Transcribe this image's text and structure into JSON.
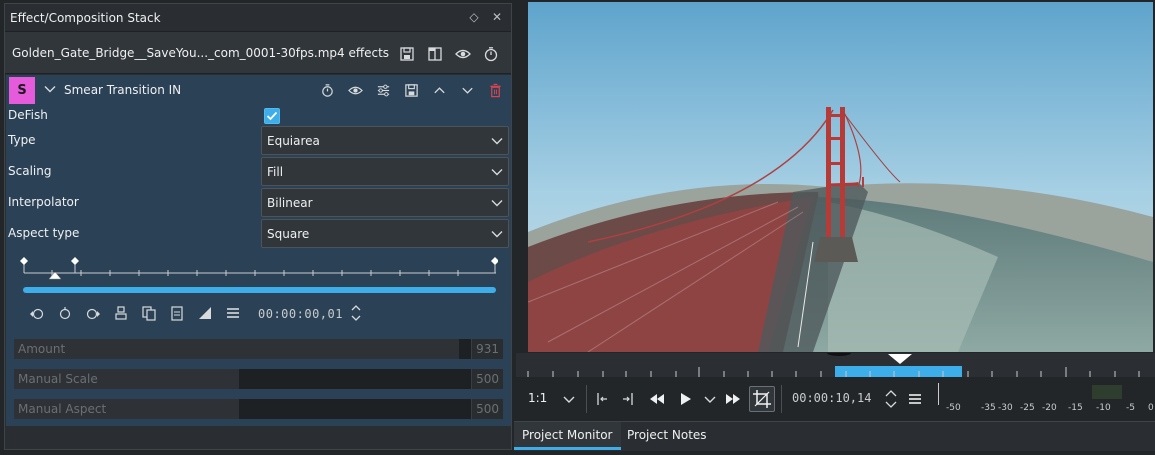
{
  "dock": {
    "title": "Effect/Composition Stack",
    "file_label": "Golden_Gate_Bridge__SaveYou..._com_0001-30fps.mp4 effects"
  },
  "effect": {
    "badge": "S",
    "name": "Smear Transition IN",
    "defish_label": "DeFish",
    "defish_checked": true,
    "params": [
      {
        "label": "Type",
        "value": "Equiarea"
      },
      {
        "label": "Scaling",
        "value": "Fill"
      },
      {
        "label": "Interpolator",
        "value": "Bilinear"
      },
      {
        "label": "Aspect type",
        "value": "Square"
      }
    ],
    "timecode": "00:00:00,01",
    "sliders": [
      {
        "label": "Amount",
        "value": "931",
        "fraction": 0.931
      },
      {
        "label": "Manual Scale",
        "value": "500",
        "fraction": 0.5
      },
      {
        "label": "Manual Aspect",
        "value": "500",
        "fraction": 0.5
      }
    ]
  },
  "monitor": {
    "zoom": "1:1",
    "timecode": "00:00:10,14",
    "audio_scale": [
      "-50",
      "-35",
      "-30",
      "-25",
      "-20",
      "-15",
      "-10",
      "-5",
      "0"
    ]
  },
  "tabs": [
    {
      "label": "Project Monitor",
      "active": true
    },
    {
      "label": "Project Notes",
      "active": false
    }
  ],
  "colors": {
    "accent": "#3daee9",
    "badge": "#e55bdc",
    "effect_bg": "#2b4256"
  }
}
